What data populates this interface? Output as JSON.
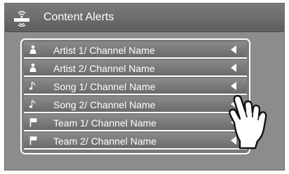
{
  "header": {
    "title": "Content Alerts",
    "logo_icon": "siriusxm-logo"
  },
  "alerts": [
    {
      "icon": "artist-icon",
      "label": "Artist 1/ Channel Name"
    },
    {
      "icon": "artist-icon",
      "label": "Artist 2/ Channel Name"
    },
    {
      "icon": "music-note-icon",
      "label": "Song 1/ Channel Name"
    },
    {
      "icon": "music-note-icon",
      "label": "Song 2/ Channel Name"
    },
    {
      "icon": "team-flag-icon",
      "label": "Team 1/ Channel Name"
    },
    {
      "icon": "team-flag-icon",
      "label": "Team 2/ Channel Name"
    }
  ],
  "colors": {
    "screen_bg": "#8c8c8c",
    "title_bar": "#6a6a6a",
    "text": "#ffffff"
  },
  "gesture": {
    "icon": "swipe-hand-icon"
  }
}
